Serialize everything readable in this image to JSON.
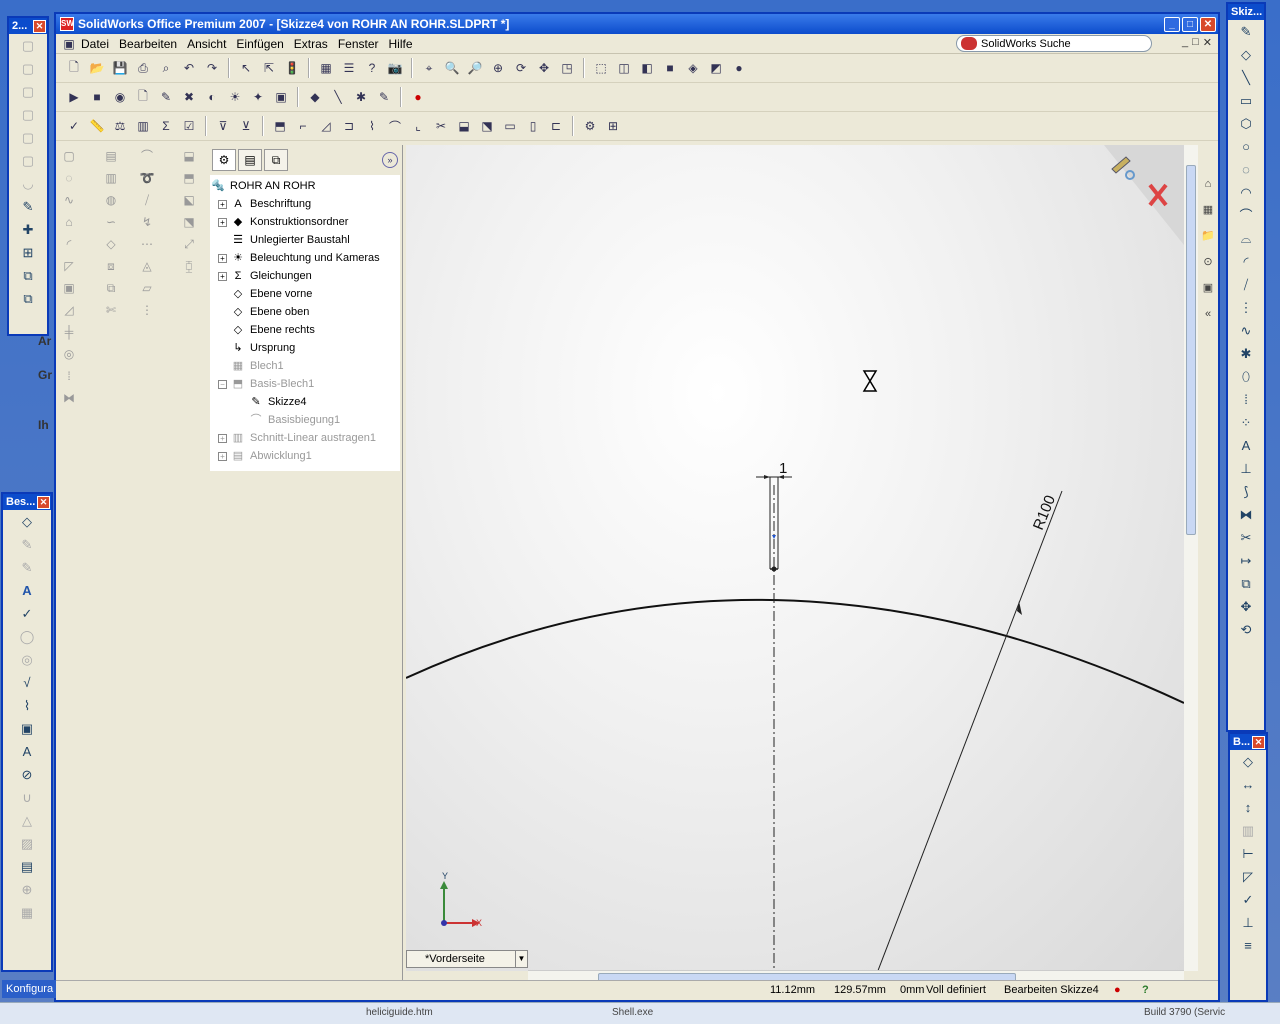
{
  "window": {
    "title": "SolidWorks Office Premium 2007 - [Skizze4 von ROHR AN ROHR.SLDPRT *]",
    "app_icon": "SW",
    "minimize": "_",
    "maximize": "□",
    "close": "✕"
  },
  "menu": {
    "items": [
      "Datei",
      "Bearbeiten",
      "Ansicht",
      "Einfügen",
      "Extras",
      "Fenster",
      "Hilfe"
    ],
    "search_placeholder": "SolidWorks Suche",
    "mdi": [
      "_",
      "□",
      "✕"
    ]
  },
  "feature_tree": {
    "root": "ROHR AN ROHR",
    "items": [
      {
        "label": "Beschriftung",
        "icon": "annotation-icon",
        "exp": "+",
        "dim": false,
        "indent": 0
      },
      {
        "label": "Konstruktionsordner",
        "icon": "design-folder-icon",
        "exp": "+",
        "dim": false,
        "indent": 0
      },
      {
        "label": "Unlegierter Baustahl",
        "icon": "material-icon",
        "exp": "",
        "dim": false,
        "indent": 0
      },
      {
        "label": "Beleuchtung und Kameras",
        "icon": "lights-icon",
        "exp": "+",
        "dim": false,
        "indent": 0
      },
      {
        "label": "Gleichungen",
        "icon": "equations-icon",
        "exp": "+",
        "dim": false,
        "indent": 0
      },
      {
        "label": "Ebene vorne",
        "icon": "plane-icon",
        "exp": "",
        "dim": false,
        "indent": 0
      },
      {
        "label": "Ebene oben",
        "icon": "plane-icon",
        "exp": "",
        "dim": false,
        "indent": 0
      },
      {
        "label": "Ebene rechts",
        "icon": "plane-icon",
        "exp": "",
        "dim": false,
        "indent": 0
      },
      {
        "label": "Ursprung",
        "icon": "origin-icon",
        "exp": "",
        "dim": false,
        "indent": 0
      },
      {
        "label": "Blech1",
        "icon": "sheetmetal-icon",
        "exp": "",
        "dim": true,
        "indent": 0
      },
      {
        "label": "Basis-Blech1",
        "icon": "base-flange-icon",
        "exp": "−",
        "dim": true,
        "indent": 0
      },
      {
        "label": "Skizze4",
        "icon": "sketch-icon",
        "exp": "",
        "dim": false,
        "indent": 1
      },
      {
        "label": "Basisbiegung1",
        "icon": "bend-icon",
        "exp": "",
        "dim": true,
        "indent": 1
      },
      {
        "label": "Schnitt-Linear austragen1",
        "icon": "cut-extrude-icon",
        "exp": "+",
        "dim": true,
        "indent": 0
      },
      {
        "label": "Abwicklung1",
        "icon": "flatten-icon",
        "exp": "+",
        "dim": true,
        "indent": 0
      }
    ]
  },
  "sketch": {
    "dimension_value": "1",
    "radius_label": "R100",
    "axis_x": "X",
    "axis_y": "Y"
  },
  "view_tab": {
    "label": "*Vorderseite",
    "dropdown": "▼"
  },
  "status": {
    "x": "11.12mm",
    "y": "129.57mm",
    "z": "0mm",
    "state": "Voll definiert",
    "mode": "Bearbeiten Skizze4",
    "help": "?"
  },
  "floating": {
    "top_left_title": "2...",
    "besch_title": "Bes...",
    "skizze_title": "Skiz...",
    "bemassung_title": "B..."
  },
  "background": {
    "konfig": "Konfigura",
    "build": "Build 3790 (Servic",
    "taskbar_item_1": "heliciguide.htm",
    "taskbar_item_2": "Shell.exe",
    "side_a": "Ar",
    "side_g": "Gr",
    "side_i": "Ih"
  }
}
